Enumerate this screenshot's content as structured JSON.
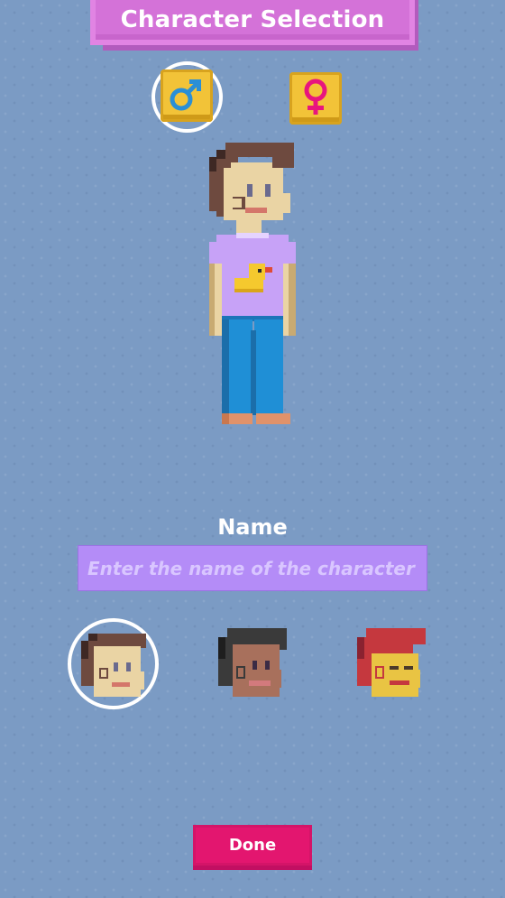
{
  "header": {
    "title": "Character Selection"
  },
  "gender": {
    "options": [
      {
        "id": "male",
        "icon": "male-symbol-icon",
        "selected": true
      },
      {
        "id": "female",
        "icon": "female-symbol-icon",
        "selected": false
      }
    ]
  },
  "name_section": {
    "label": "Name",
    "value": "",
    "placeholder": "Enter the name of the character"
  },
  "heads": {
    "options": [
      {
        "id": "brown-hair-light-skin",
        "selected": true
      },
      {
        "id": "black-hair-dark-skin",
        "selected": false
      },
      {
        "id": "red-hair-yellow-skin",
        "selected": false
      }
    ]
  },
  "footer": {
    "done_label": "Done"
  },
  "colors": {
    "background": "#7b9bc4",
    "banner": "#d472d8",
    "gender_button": "#f2c338",
    "male_symbol": "#2a8fd6",
    "female_symbol": "#e8157e",
    "input_fill": "#b48cf7",
    "done_button": "#e3166f",
    "selection_ring": "#ffffff"
  }
}
